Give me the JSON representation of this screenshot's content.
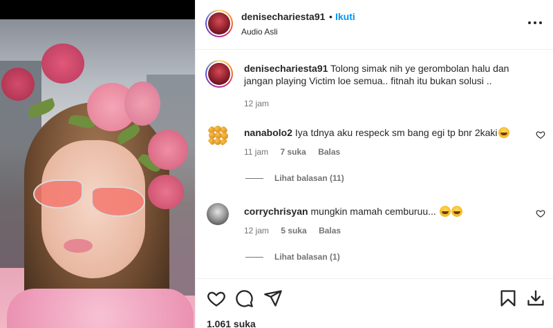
{
  "post": {
    "username": "denisechariesta91",
    "separator": "•",
    "follow_label": "Ikuti",
    "audio_label": "Audio Asli",
    "more_icon": "more-options-icon"
  },
  "caption": {
    "username": "denisechariesta91",
    "text": " Tolong simak nih ye gerombolan halu dan jangan playing Victim loe semua.. fitnah itu bukan solusi ..",
    "time": "12 jam"
  },
  "comments": [
    {
      "username": "nanabolo2",
      "text": " Iya tdnya aku respeck sm bang egi tp bnr 2kaki",
      "time": "11 jam",
      "likes": "7 suka",
      "reply_label": "Balas",
      "view_replies": "Lihat balasan (11)"
    },
    {
      "username": "corrychrisyan",
      "text": " mungkin mamah cemburuu... ",
      "time": "12 jam",
      "likes": "5 suka",
      "reply_label": "Balas",
      "view_replies": "Lihat balasan (1)"
    }
  ],
  "actions": {
    "icons": [
      "heart-icon",
      "comment-icon",
      "share-icon",
      "bookmark-icon",
      "download-icon"
    ],
    "likes_count": "1.061 suka"
  },
  "colors": {
    "accent_blue": "#0095f6",
    "text": "#262626",
    "muted": "#737373",
    "divider": "#efefef"
  }
}
